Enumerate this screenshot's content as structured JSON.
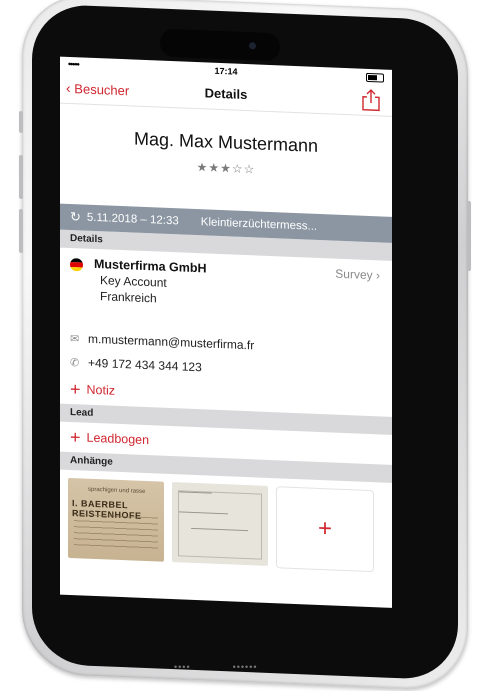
{
  "status_bar": {
    "time": "17:14",
    "signal": "•••••"
  },
  "nav": {
    "back_label": "Besucher",
    "title": "Details"
  },
  "contact": {
    "name": "Mag. Max Mustermann",
    "rating_text": "★★★☆☆",
    "rating": 3,
    "rating_max": 5
  },
  "event": {
    "date": "5.11.2018 – 12:33",
    "name": "Kleintierzüchtermess..."
  },
  "sections": {
    "details": "Details",
    "lead": "Lead",
    "attachments": "Anhänge"
  },
  "company": {
    "name": "Musterfirma GmbH",
    "position": "Key Account",
    "country": "Frankreich",
    "survey_label": "Survey",
    "flag_colors": [
      "#000000",
      "#dd0000",
      "#ffce00"
    ]
  },
  "details": {
    "email": "m.mustermann@musterfirma.fr",
    "phone": "+49 172 434 344 123",
    "add_note_label": "Notiz"
  },
  "lead": {
    "add_label": "Leadbogen"
  },
  "attachments": {
    "thumb1_caption": "I. BAERBEL REISTENHOFE",
    "thumb1_subtitle": "sprachigen und rasse",
    "add_symbol": "+"
  },
  "colors": {
    "accent": "#d0262f",
    "event_bar": "#8b96a2",
    "section_bg": "#d9d9db"
  }
}
